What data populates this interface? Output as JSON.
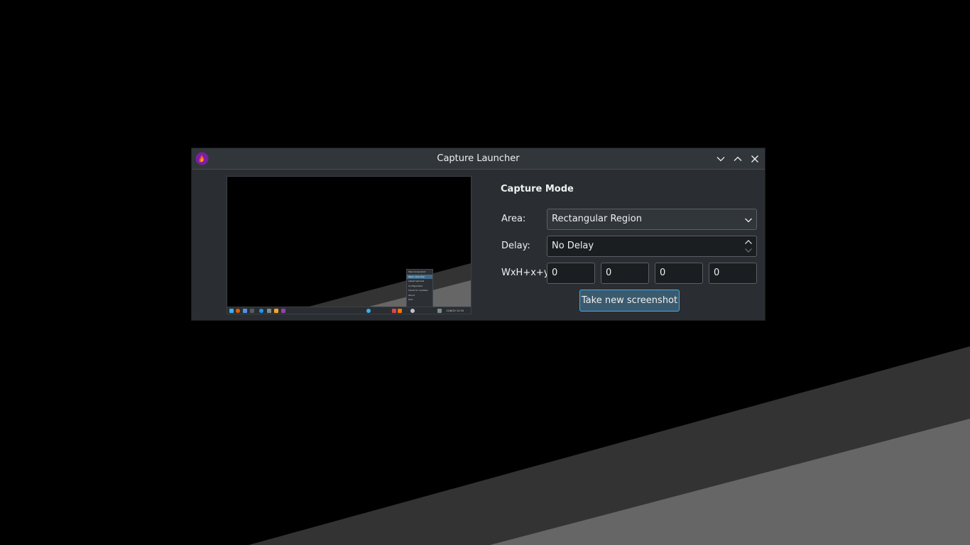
{
  "window": {
    "title": "Capture Launcher",
    "app_icon": "flameshot-icon",
    "titlebar_buttons": [
      "minimize-icon",
      "maximize-icon",
      "close-icon"
    ]
  },
  "preview": {
    "menu_items": [
      "Take Screenshot",
      "Open Launcher",
      "Latest Uploads",
      "Configuration",
      "Check for updates",
      "About",
      "Quit"
    ],
    "selected_menu_item": "Open Launcher",
    "clock": "12/8/22 12:34"
  },
  "capture": {
    "section_title": "Capture Mode",
    "area_label": "Area:",
    "area_value": "Rectangular Region",
    "delay_label": "Delay:",
    "delay_value": "No Delay",
    "geometry_label": "WxH+x+y",
    "geometry_values": [
      "0",
      "0",
      "0",
      "0"
    ],
    "take_button": "Take new screenshot"
  },
  "colors": {
    "window_bg": "#2a2e32",
    "titlebar_bg": "#31363b",
    "accent": "#3daee9",
    "button_bg": "#3b5a6e",
    "text": "#eff0f1"
  }
}
